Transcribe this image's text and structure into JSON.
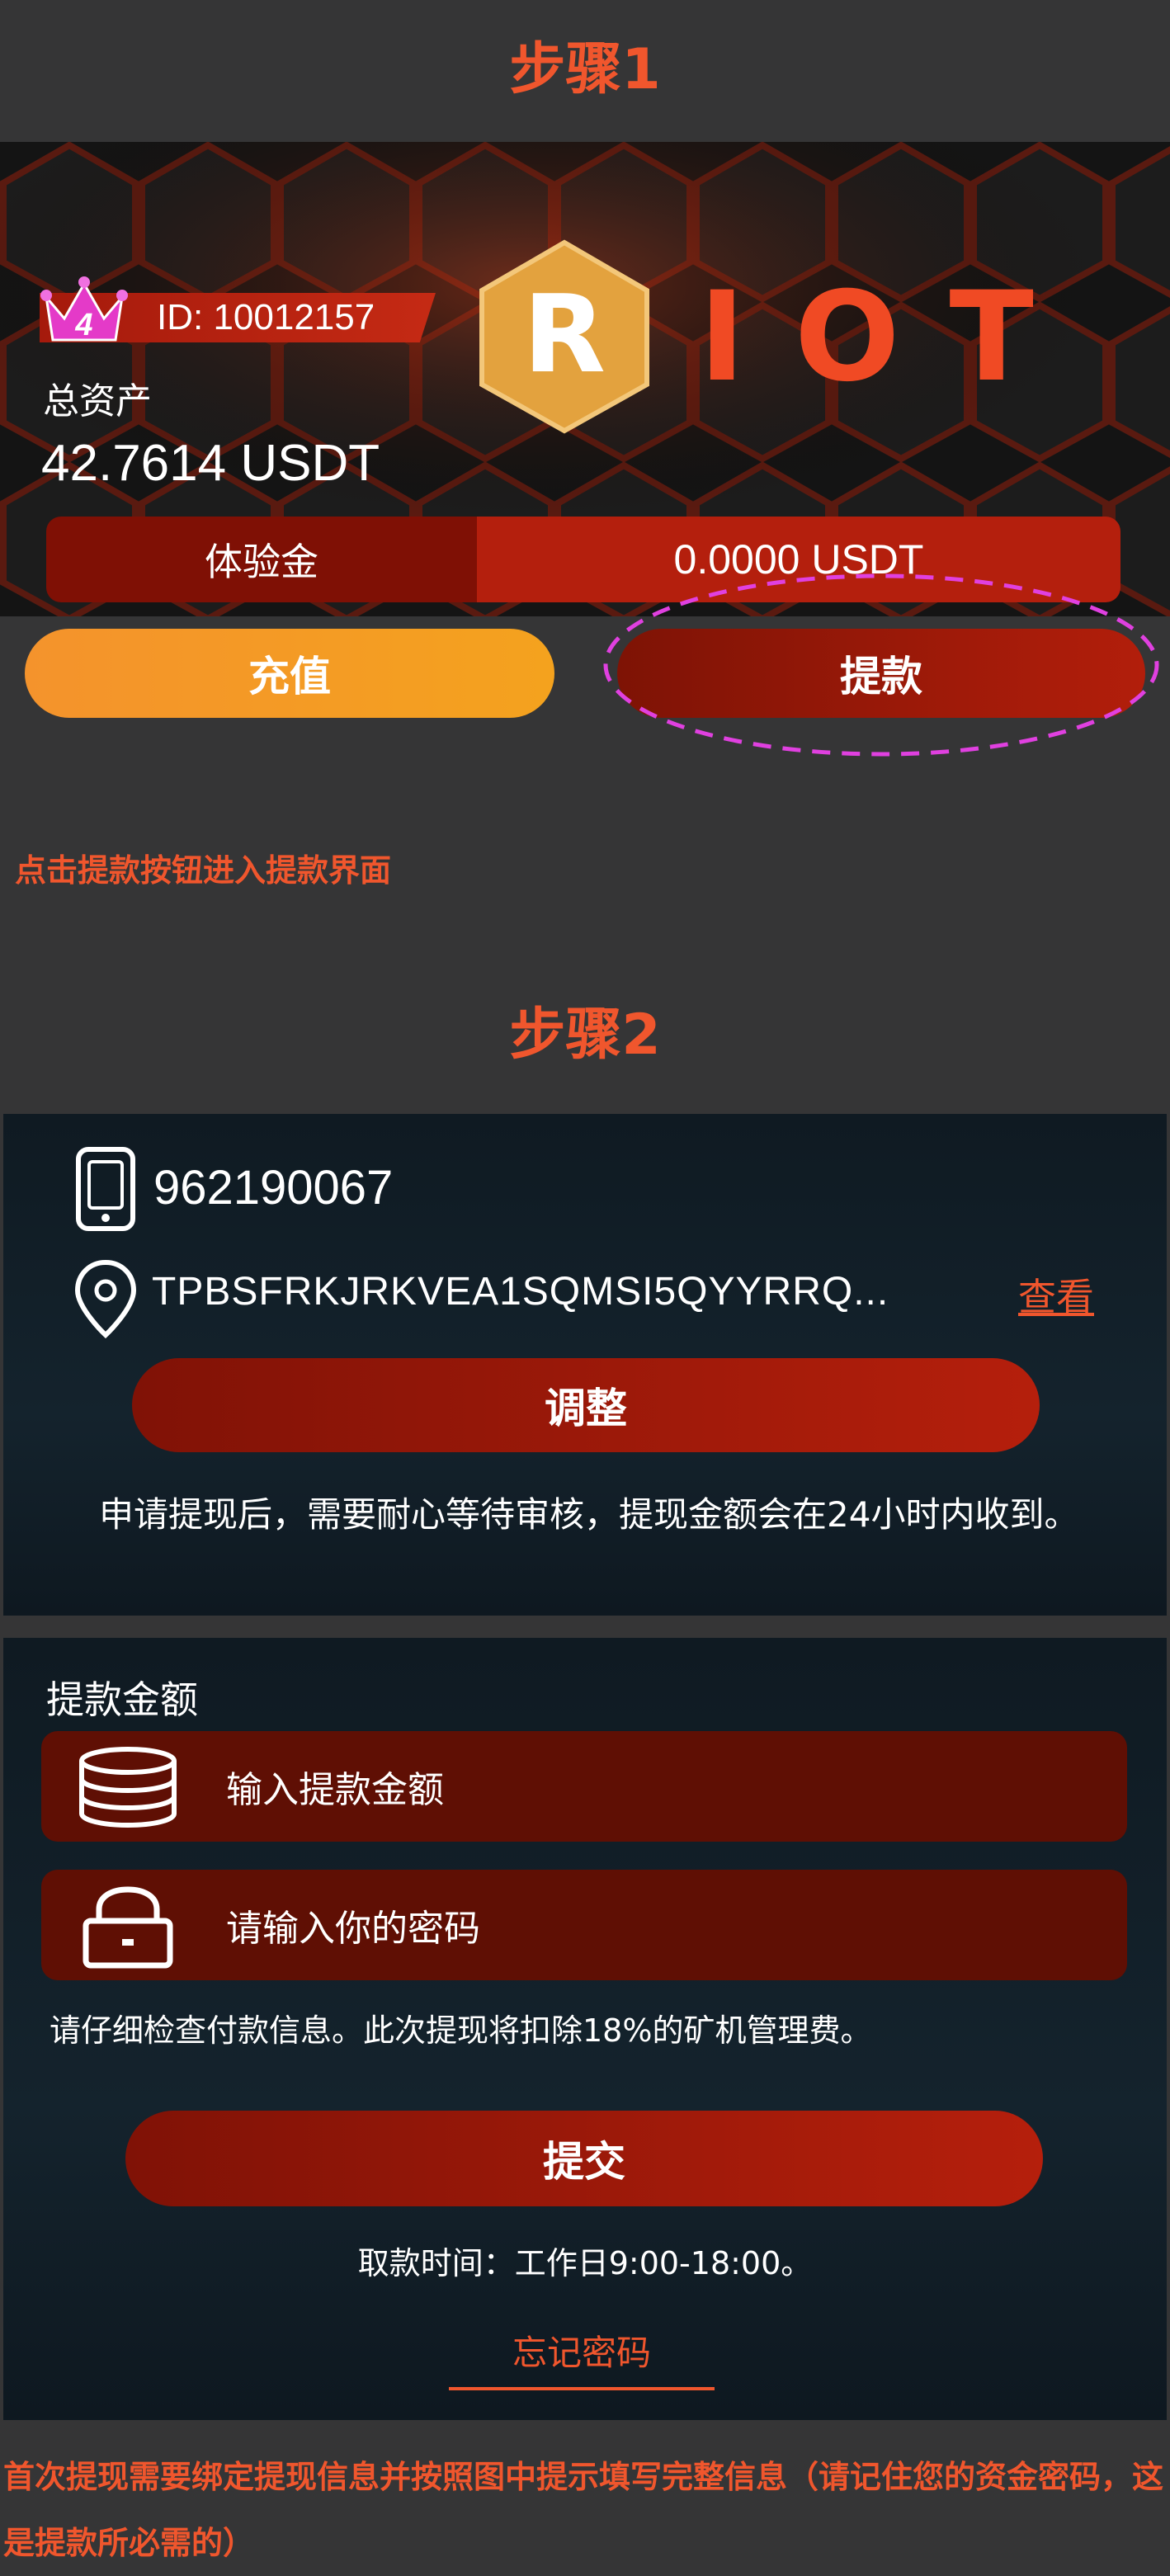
{
  "step1": {
    "title": "步骤1",
    "vip_level": "4",
    "user_id": "ID: 10012157",
    "logo": {
      "left": "R",
      "text": "IOT"
    },
    "total_assets_label": "总资产",
    "total_assets_value": "42.7614 USDT",
    "experience_label": "体验金",
    "experience_value": "0.0000 USDT",
    "recharge_label": "充值",
    "withdraw_label": "提款",
    "instruction": "点击提款按钮进入提款界面"
  },
  "step2": {
    "title": "步骤2",
    "phone": "962190067",
    "wallet_address": "TPBSFRKJRKVEA1SQMSI5QYYRRQ...",
    "view_label": "查看",
    "adjust_label": "调整",
    "notice": "申请提现后，需要耐心等待审核，提现金额会在24小时内收到。",
    "amount_section_label": "提款金额",
    "amount_placeholder": "输入提款金额",
    "password_placeholder": "请输入你的密码",
    "check_info": "请仔细检查付款信息。此次提现将扣除18%的矿机管理费。",
    "submit_label": "提交",
    "withdraw_time": "取款时间：工作日9:00-18:00。",
    "forgot_password": "忘记密码",
    "final_note": "首次提现需要绑定提现信息并按照图中提示填写完整信息（请记住您的资金密码，这是提款所必需的）"
  },
  "colors": {
    "accent": "#f0562d",
    "dark_red": "#7e1305",
    "red": "#b21e0b",
    "orange": "#f4932c",
    "highlight": "#e040e0"
  },
  "icons": [
    "crown-icon",
    "phone-icon",
    "location-pin-icon",
    "database-icon",
    "lock-icon"
  ]
}
